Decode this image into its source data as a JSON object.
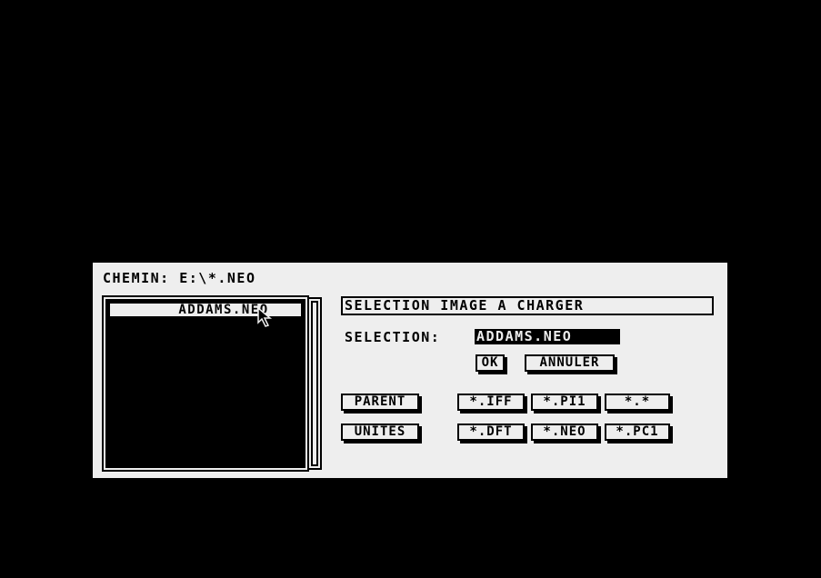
{
  "path_label": "CHEMIN: E:\\*.NEO",
  "files": [
    {
      "name": "ADDAMS.NEO"
    }
  ],
  "dialog_title": "SELECTION IMAGE A CHARGER",
  "selection": {
    "label": "SELECTION:",
    "value": "ADDAMS.NEO"
  },
  "buttons": {
    "ok": "OK",
    "cancel": "ANNULER",
    "parent": "PARENT",
    "drives": "UNITES",
    "iff": "*.IFF",
    "pi1": "*.PI1",
    "all": "*.*",
    "dft": "*.DFT",
    "neo": "*.NEO",
    "pc1": "*.PC1"
  },
  "colors": {
    "background": "#000000",
    "dialog": "#eeeeee",
    "ink": "#000000"
  },
  "icons": {
    "cursor": "mouse-pointer-icon"
  }
}
